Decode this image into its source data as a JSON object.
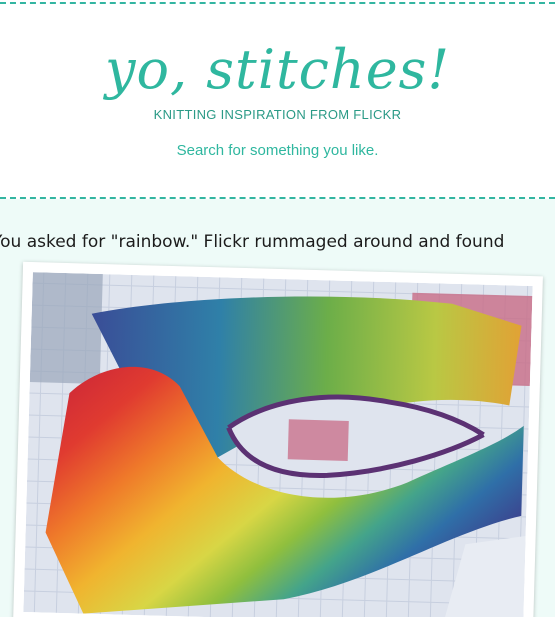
{
  "header": {
    "logo": "yo, stitches!",
    "tagline": "KNITTING INSPIRATION FROM FLICKR",
    "search_link": "Search for something you like."
  },
  "results": {
    "message": "You asked for \"rainbow.\" Flickr rummaged around and found"
  },
  "photo": {
    "subject": "rainbow knitted shawl on quilt",
    "colors": [
      "#c8223a",
      "#e8502a",
      "#f0a32b",
      "#e9d44a",
      "#8fb83a",
      "#3aa07a",
      "#2f6fa8",
      "#3d3f8c",
      "#6a2d6e"
    ]
  },
  "colors": {
    "accent": "#2fb79f",
    "content_bg": "#eefbf8"
  }
}
